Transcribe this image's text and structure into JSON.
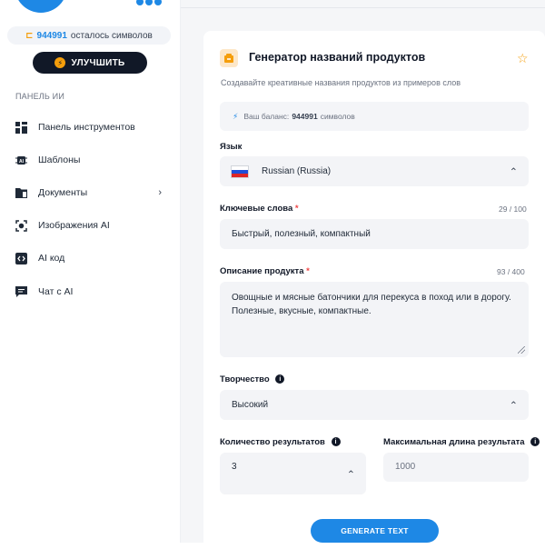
{
  "sidebar": {
    "credits_count": "944991",
    "credits_label": "осталось символов",
    "upgrade_label": "УЛУЧШИТЬ",
    "panel_label": "ПАНЕЛЬ ИИ",
    "items": [
      {
        "label": "Панель инструментов",
        "icon": "dashboard-icon"
      },
      {
        "label": "Шаблоны",
        "icon": "ai-templates-icon"
      },
      {
        "label": "Документы",
        "icon": "folder-icon"
      },
      {
        "label": "Изображения AI",
        "icon": "image-scan-icon"
      },
      {
        "label": "AI код",
        "icon": "code-icon"
      },
      {
        "label": "Чат с AI",
        "icon": "chat-icon"
      }
    ]
  },
  "card": {
    "title": "Генератор названий продуктов",
    "subtitle": "Создавайте креативные названия продуктов из примеров слов",
    "balance_prefix": "Ваш баланс:",
    "balance_value": "944991",
    "balance_suffix": "символов"
  },
  "form": {
    "language_label": "Язык",
    "language_value": "Russian (Russia)",
    "keywords_label": "Ключевые слова",
    "keywords_counter": "29 / 100",
    "keywords_value": "Быстрый, полезный, компактный",
    "description_label": "Описание продукта",
    "description_counter": "93 / 400",
    "description_value": "Овощные и мясные батончики для перекуса в поход или в дорогу. Полезные, вкусные, компактные.",
    "creativity_label": "Творчество",
    "creativity_value": "Высокий",
    "results_label": "Количество результатов",
    "results_value": "3",
    "maxlen_label": "Максимальная длина результата",
    "maxlen_placeholder": "1000",
    "required_mark": "*",
    "info_mark": "i",
    "generate_label": "GENERATE TEXT"
  },
  "colors": {
    "accent": "#1e88e5",
    "upgrade_bg": "#111827",
    "star": "#f59e0b"
  }
}
